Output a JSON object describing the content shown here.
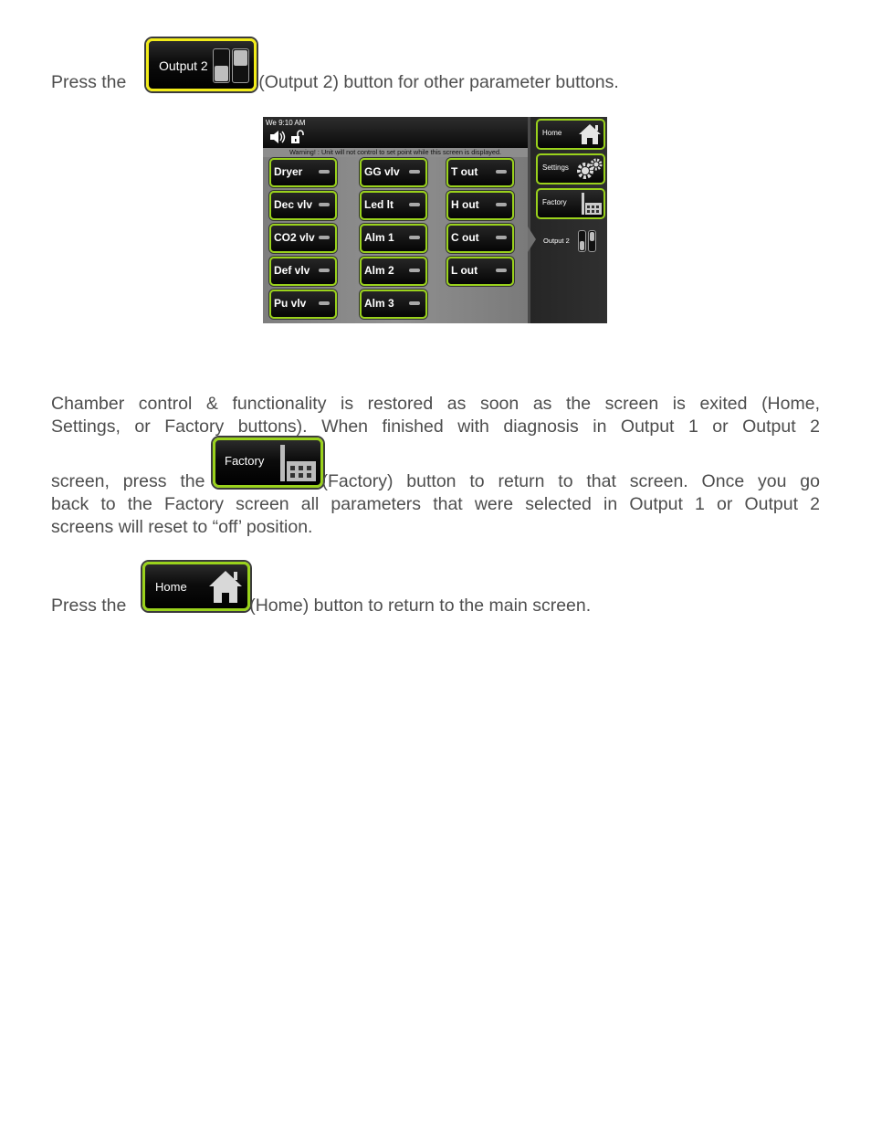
{
  "intro": {
    "prefix": "Press the",
    "suffix": "(Output 2) button for other parameter buttons.",
    "button_label": "Output 2",
    "button_icon": "output-switch-icon"
  },
  "screen": {
    "clock": "We 9:10 AM",
    "status_icons": [
      "speaker-icon",
      "unlock-icon"
    ],
    "warning": "Warning! : Unit will not control to set point while this screen is displayed.",
    "params": [
      {
        "label": "Dryer",
        "state": "off"
      },
      {
        "label": "Dec vlv",
        "state": "off"
      },
      {
        "label": "CO2 vlv",
        "state": "off"
      },
      {
        "label": "Def vlv",
        "state": "off"
      },
      {
        "label": "Pu vlv",
        "state": "off"
      },
      {
        "label": "GG vlv",
        "state": "off"
      },
      {
        "label": "Led lt",
        "state": "off"
      },
      {
        "label": "Alm 1",
        "state": "off"
      },
      {
        "label": "Alm 2",
        "state": "off"
      },
      {
        "label": "Alm 3",
        "state": "off"
      },
      {
        "label": "T out",
        "state": "off"
      },
      {
        "label": "H out",
        "state": "off"
      },
      {
        "label": "C out",
        "state": "off"
      },
      {
        "label": "L out",
        "state": "off"
      }
    ],
    "sidebar": {
      "home": "Home",
      "settings": "Settings",
      "factory": "Factory",
      "active": "Output 2"
    },
    "colors": {
      "button_border": "#9ad21c",
      "active_border": "#f2ec1a"
    }
  },
  "body": {
    "line1": "Chamber control & functionality is restored as soon as the screen is exited (Home,",
    "line2": "Settings, or Factory buttons). When finished with diagnosis in Output 1 or Output 2",
    "line3_prefix": "screen, press the",
    "line3_suffix": "(Factory) button to return to that screen.  Once you go",
    "line4": "back to the Factory screen all parameters that were selected in Output 1 or Output 2",
    "line5": "screens will reset to “off’ position.",
    "factory_label": "Factory"
  },
  "home_para": {
    "prefix": "Press the",
    "suffix": "(Home) button to return to the main screen.",
    "button_label": "Home"
  }
}
